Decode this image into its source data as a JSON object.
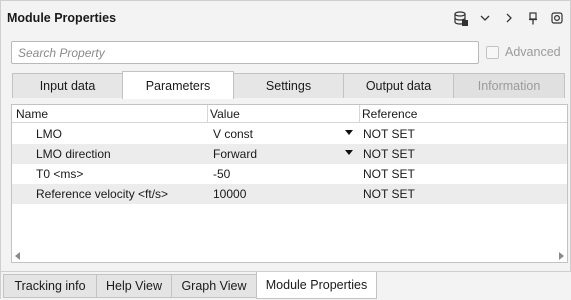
{
  "panel": {
    "title": "Module Properties"
  },
  "title_icons": [
    "database-icon",
    "chevron-down-icon",
    "chevron-right-icon",
    "pin-icon",
    "maximize-icon"
  ],
  "search": {
    "placeholder": "Search Property",
    "value": ""
  },
  "advanced": {
    "label": "Advanced",
    "checked": false
  },
  "tabs": [
    {
      "label": "Input data",
      "state": "normal"
    },
    {
      "label": "Parameters",
      "state": "active"
    },
    {
      "label": "Settings",
      "state": "normal"
    },
    {
      "label": "Output data",
      "state": "normal"
    },
    {
      "label": "Information",
      "state": "disabled"
    }
  ],
  "grid": {
    "columns": [
      "Name",
      "Value",
      "Reference"
    ],
    "rows": [
      {
        "name": "LMO",
        "value": "V const",
        "reference": "NOT SET",
        "dropdown": true
      },
      {
        "name": "LMO direction",
        "value": "Forward",
        "reference": "NOT SET",
        "dropdown": true
      },
      {
        "name": "T0 <ms>",
        "value": "-50",
        "reference": "NOT SET",
        "dropdown": false
      },
      {
        "name": "Reference velocity <ft/s>",
        "value": "10000",
        "reference": "NOT SET",
        "dropdown": false
      }
    ]
  },
  "bottom_tabs": [
    {
      "label": "Tracking info",
      "state": "normal"
    },
    {
      "label": "Help View",
      "state": "normal"
    },
    {
      "label": "Graph View",
      "state": "normal"
    },
    {
      "label": "Module Properties",
      "state": "active"
    }
  ],
  "colors": {
    "panel_bg": "#f3f3f3",
    "alt_row": "#ececec",
    "disabled_text": "#9b9b9b",
    "border": "#c3c3c3"
  }
}
